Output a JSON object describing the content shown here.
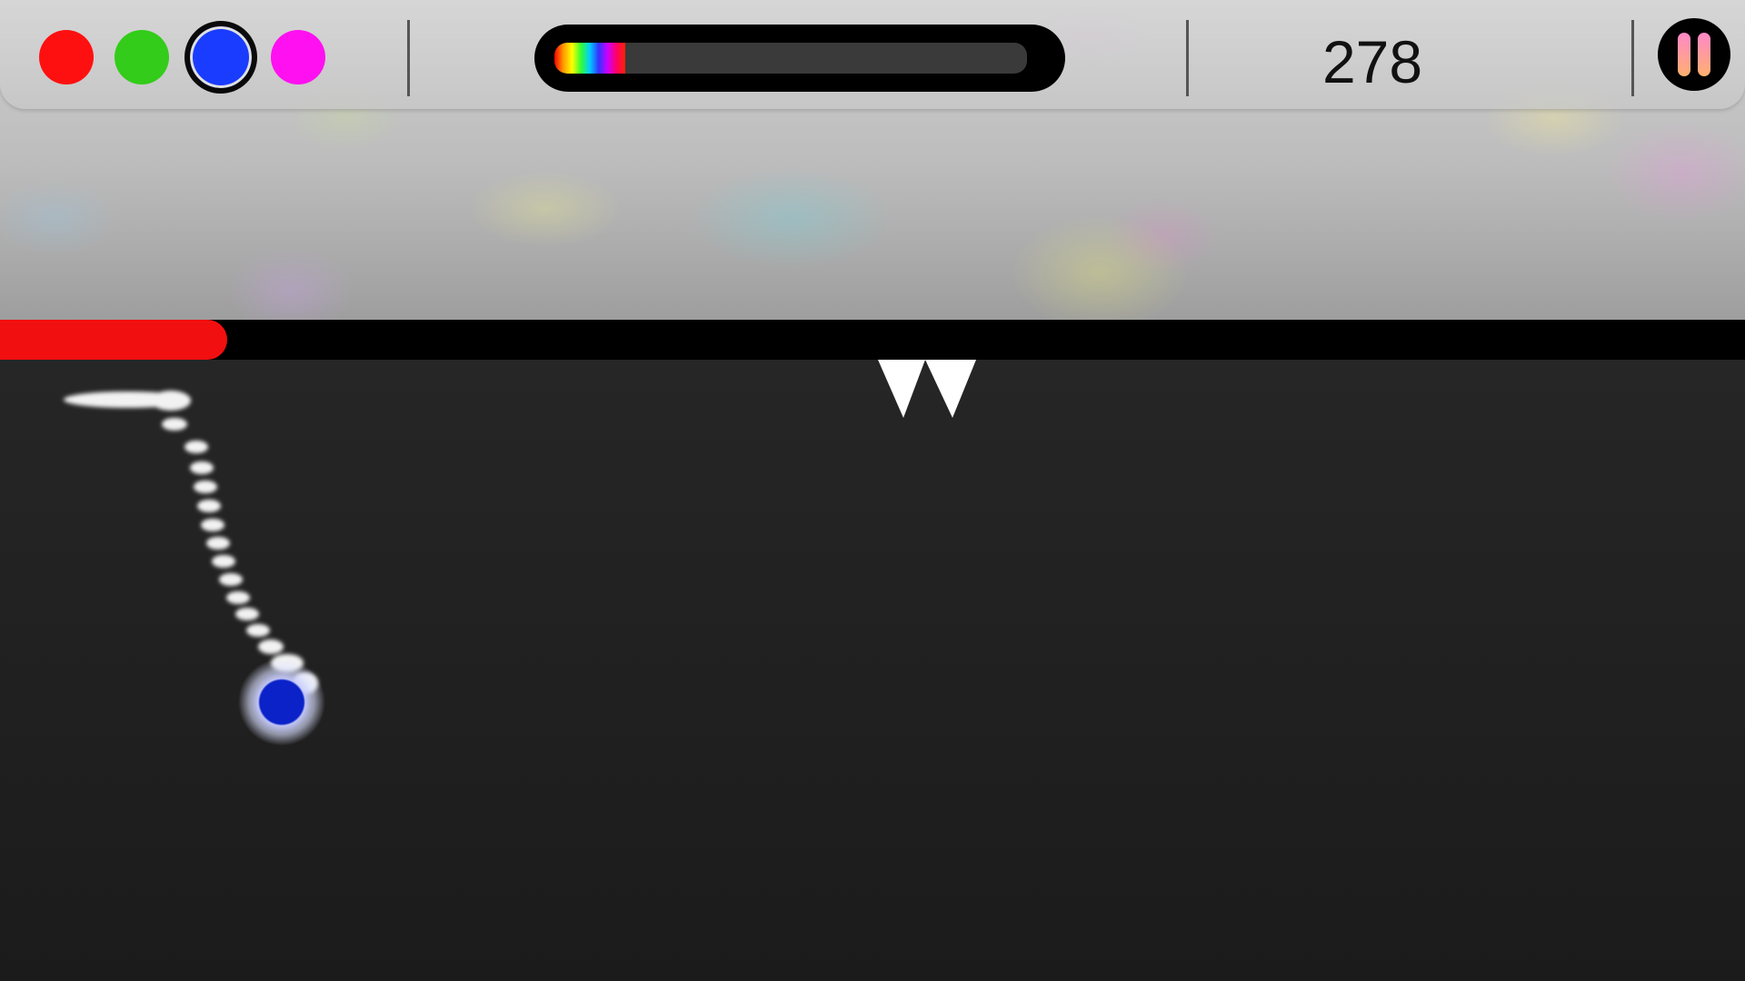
{
  "hud": {
    "colors": [
      {
        "name": "red",
        "hex": "#ff1010",
        "selected": false
      },
      {
        "name": "green",
        "hex": "#33cc1a",
        "selected": false
      },
      {
        "name": "blue",
        "hex": "#1a3cff",
        "selected": true
      },
      {
        "name": "magenta",
        "hex": "#ff10f0",
        "selected": false
      }
    ],
    "rainbow_meter_fraction": 0.15,
    "score": "278",
    "pause_icon": "pause-icon"
  },
  "level": {
    "progress_fraction": 0.13,
    "progress_color": "#f20f0f",
    "hazard": "spike-icon",
    "hazard_count": 2
  },
  "player": {
    "color": "#0a22c8"
  }
}
